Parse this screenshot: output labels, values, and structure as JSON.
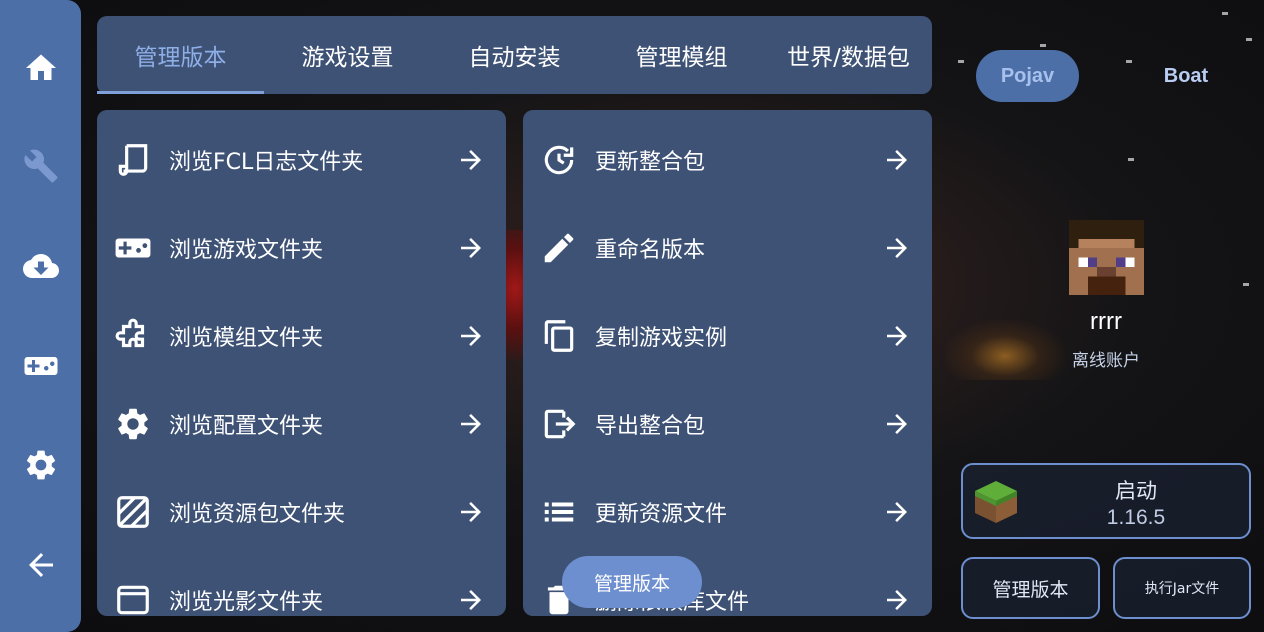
{
  "tabs": [
    {
      "label": "管理版本",
      "active": true
    },
    {
      "label": "游戏设置"
    },
    {
      "label": "自动安装"
    },
    {
      "label": "管理模组"
    },
    {
      "label": "世界/数据包"
    }
  ],
  "sidebar": {
    "items": [
      {
        "icon": "home-icon"
      },
      {
        "icon": "wrench-icon",
        "active": true
      },
      {
        "icon": "cloud-download-icon"
      },
      {
        "icon": "gamepad-icon"
      },
      {
        "icon": "gear-icon"
      },
      {
        "icon": "back-arrow-icon"
      }
    ]
  },
  "left_panel": {
    "items": [
      {
        "label": "浏览FCL日志文件夹",
        "icon": "scroll-icon"
      },
      {
        "label": "浏览游戏文件夹",
        "icon": "gamepad-icon"
      },
      {
        "label": "浏览模组文件夹",
        "icon": "puzzle-icon"
      },
      {
        "label": "浏览配置文件夹",
        "icon": "gear-icon"
      },
      {
        "label": "浏览资源包文件夹",
        "icon": "texture-icon"
      },
      {
        "label": "浏览光影文件夹",
        "icon": "window-icon"
      }
    ]
  },
  "right_panel": {
    "items": [
      {
        "label": "更新整合包",
        "icon": "update-icon"
      },
      {
        "label": "重命名版本",
        "icon": "pencil-icon"
      },
      {
        "label": "复制游戏实例",
        "icon": "copy-icon"
      },
      {
        "label": "导出整合包",
        "icon": "export-icon"
      },
      {
        "label": "更新资源文件",
        "icon": "list-icon"
      },
      {
        "label": "删除依赖库文件",
        "icon": "trash-icon"
      }
    ]
  },
  "floating_label": "管理版本",
  "launchers": {
    "pojav": "Pojav",
    "boat": "Boat",
    "selected": "Pojav"
  },
  "account": {
    "name": "rrrr",
    "type": "离线账户",
    "avatar": "steve-avatar"
  },
  "launch": {
    "label": "启动",
    "version": "1.16.5",
    "icon": "grass-block-icon"
  },
  "bottom_buttons": {
    "manage": "管理版本",
    "run_jar": "执行Jar文件"
  },
  "colors": {
    "rail": "#4d6fa8",
    "panel": "#3e5275",
    "accent": "#7f9fd8",
    "pill": "#6d8fd0"
  }
}
